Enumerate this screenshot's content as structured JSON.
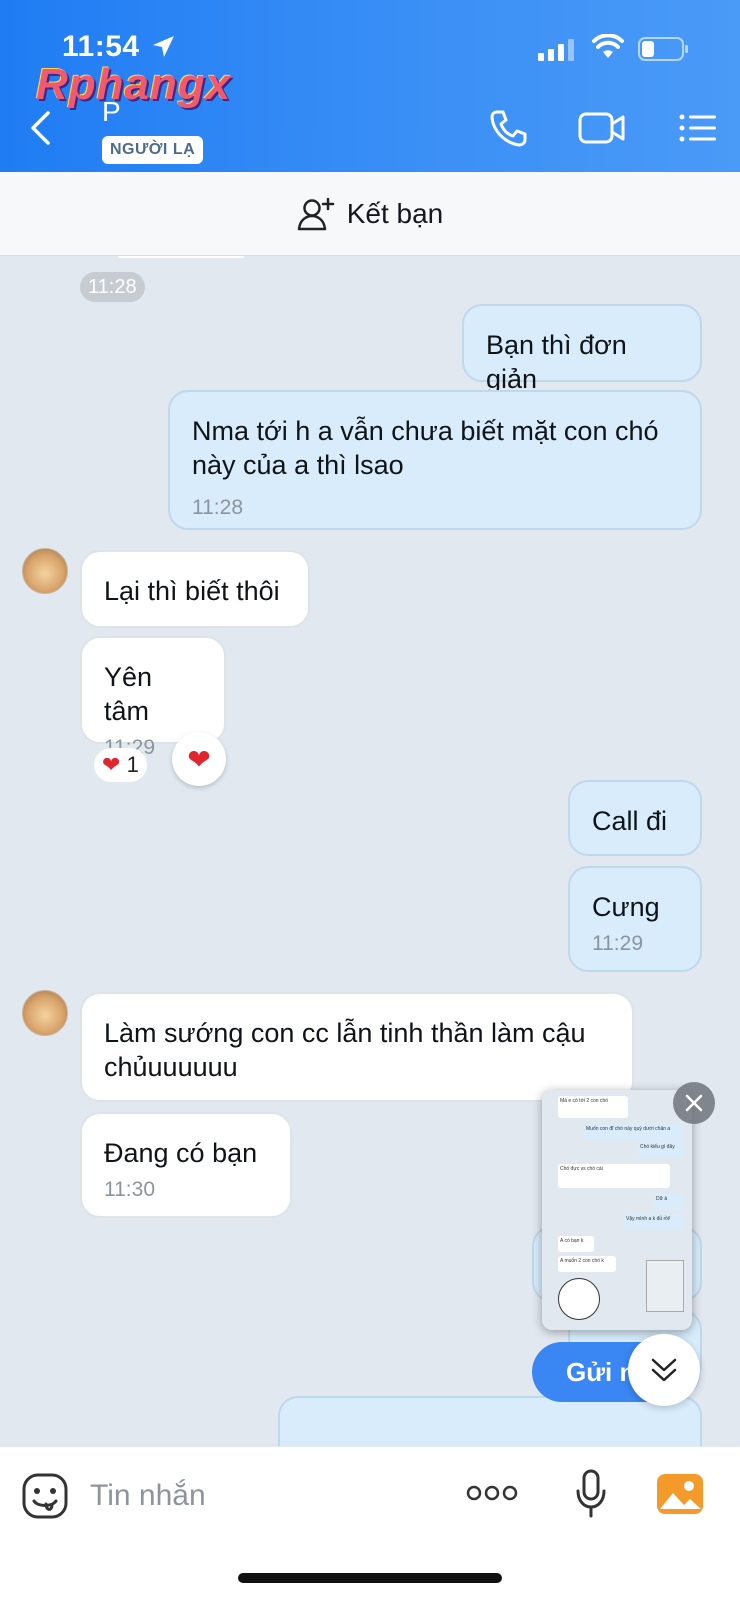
{
  "status": {
    "time": "11:54"
  },
  "watermark": "Rphangx",
  "header": {
    "contact_name": "P",
    "badge": "NGƯỜI LẠ"
  },
  "friend_bar": {
    "label": "Kết bạn"
  },
  "messages": {
    "ts_top": "11:28",
    "m1": "Bạn thì đơn giản",
    "m2": "Nma tới h a vẫn chưa biết mặt con chó này của a thì lsao",
    "m2_time": "11:28",
    "m3": "Lại thì biết thôi",
    "m4": "Yên tâm",
    "m4_time": "11:29",
    "m4_reaction_count": "1",
    "m5": "Call đi",
    "m6": "Cưng",
    "m6_time": "11:29",
    "m7": "Làm sướng con cc lẫn tinh thần làm cậu chủuuuuuu",
    "m8": "Đang có bạn",
    "m8_time": "11:30"
  },
  "pip_preview": {
    "lines": [
      "Mà e có tới 2 con chó",
      "A muốn cả 2 phục vụ a k",
      "Muốn con đĩ chó này quỳ dưới chân a",
      "Chó kiểu gì đây",
      "Chó đực vs chó cái",
      "Nhưng cả 2 điều bò phục vụ dưới chân a",
      "Dữ à",
      "Vậy mình a k đủ rồi!",
      "A có bạn k",
      "A muốn 2 con chó k"
    ]
  },
  "send_button": {
    "label": "Gửi n"
  },
  "input": {
    "placeholder": "Tin nhắn"
  }
}
